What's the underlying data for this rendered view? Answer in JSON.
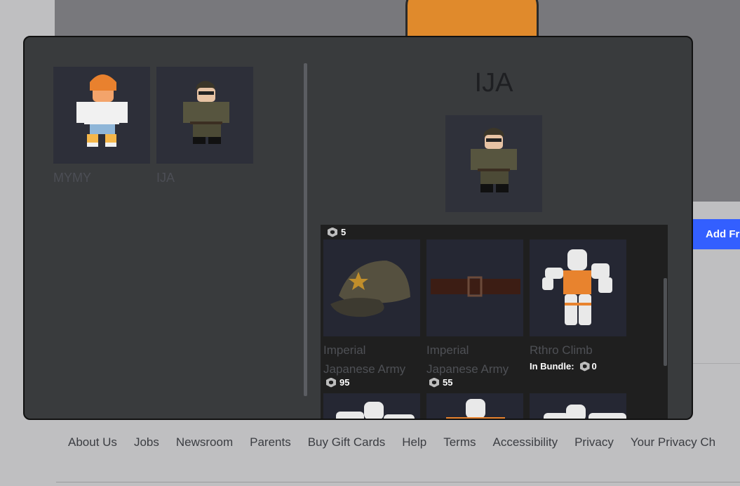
{
  "background": {
    "add_friend_label": "Add Fr",
    "footer_links": [
      "About Us",
      "Jobs",
      "Newsroom",
      "Parents",
      "Buy Gift Cards",
      "Help",
      "Terms",
      "Accessibility",
      "Privacy",
      "Your Privacy Ch"
    ]
  },
  "outfits": [
    {
      "name": "MYMY"
    },
    {
      "name": "IJA"
    }
  ],
  "detail": {
    "title": "IJA"
  },
  "items_panel": {
    "top_price": "5",
    "items": [
      {
        "name_line1": "Imperial",
        "name_line2": "Japanese Army",
        "price": "95"
      },
      {
        "name_line1": "Imperial",
        "name_line2": "Japanese Army",
        "price": "55"
      },
      {
        "name_line1": "Rthro Climb",
        "bundle_label": "In Bundle:",
        "price": "0"
      }
    ]
  },
  "colors": {
    "modal_bg": "#393b3d",
    "panel_bg": "#1f1f1f",
    "accent": "#335fff"
  }
}
